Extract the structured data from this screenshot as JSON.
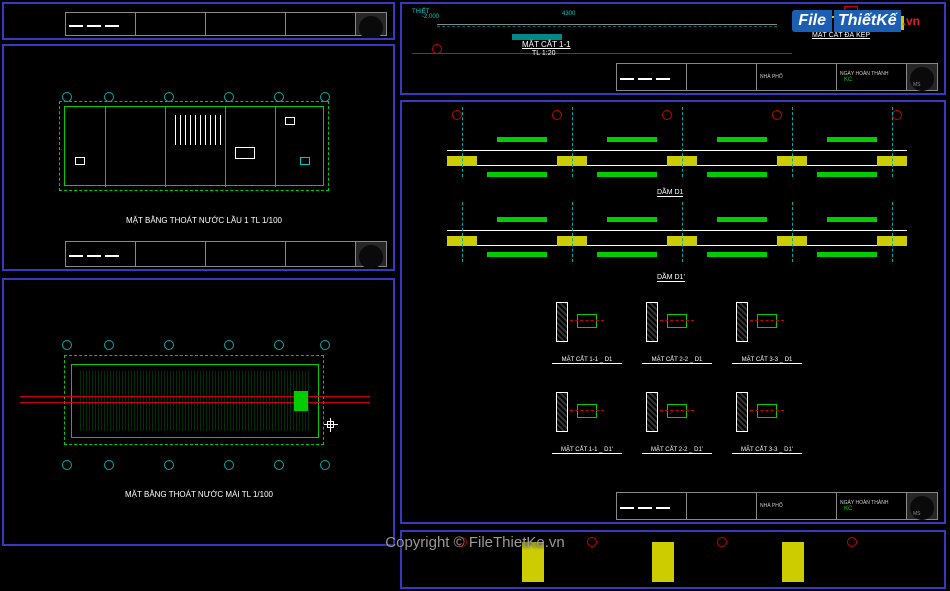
{
  "watermark": {
    "logo_file": "File",
    "logo_thietke": "ThiếtKế",
    "logo_vn": ".vn",
    "center": "Copyright © FileThietKe.vn"
  },
  "panel2": {
    "title": "MẶT BẰNG THOÁT NƯỚC LẦU 1 TL 1/100"
  },
  "panel3": {
    "title": "MẶT BẰNG THOÁT NƯỚC MÁI TL 1/100"
  },
  "panel4": {
    "section1": "MẶT CẮT 1-1",
    "section1_scale": "TL 1:20",
    "section2": "MẶT CẮT ĐÁ KẸP",
    "dim1": "-2.000",
    "dim2": "4300",
    "project_label": "NHÀ PHỐ",
    "date_label": "NGÀY HOÀN THÀNH"
  },
  "panel5": {
    "beam_label_1": "DẦM D1",
    "beam_label_2": "DẦM D1'",
    "sections": [
      "MẶT CẮT 1-1 _ D1",
      "MẶT CẮT 2-2 _ D1",
      "MẶT CẮT 3-3 _ D1",
      "MẶT CẮT 1-1 _ D1'",
      "MẶT CẮT 2-2 _ D1'",
      "MẶT CẮT 3-3 _ D1'"
    ],
    "project_label": "NHÀ PHỐ",
    "date_label": "NGÀY HOÀN THÀNH"
  },
  "title_block": {
    "kc": "KC",
    "ms": "MS",
    "thiet": "THIẾT"
  }
}
